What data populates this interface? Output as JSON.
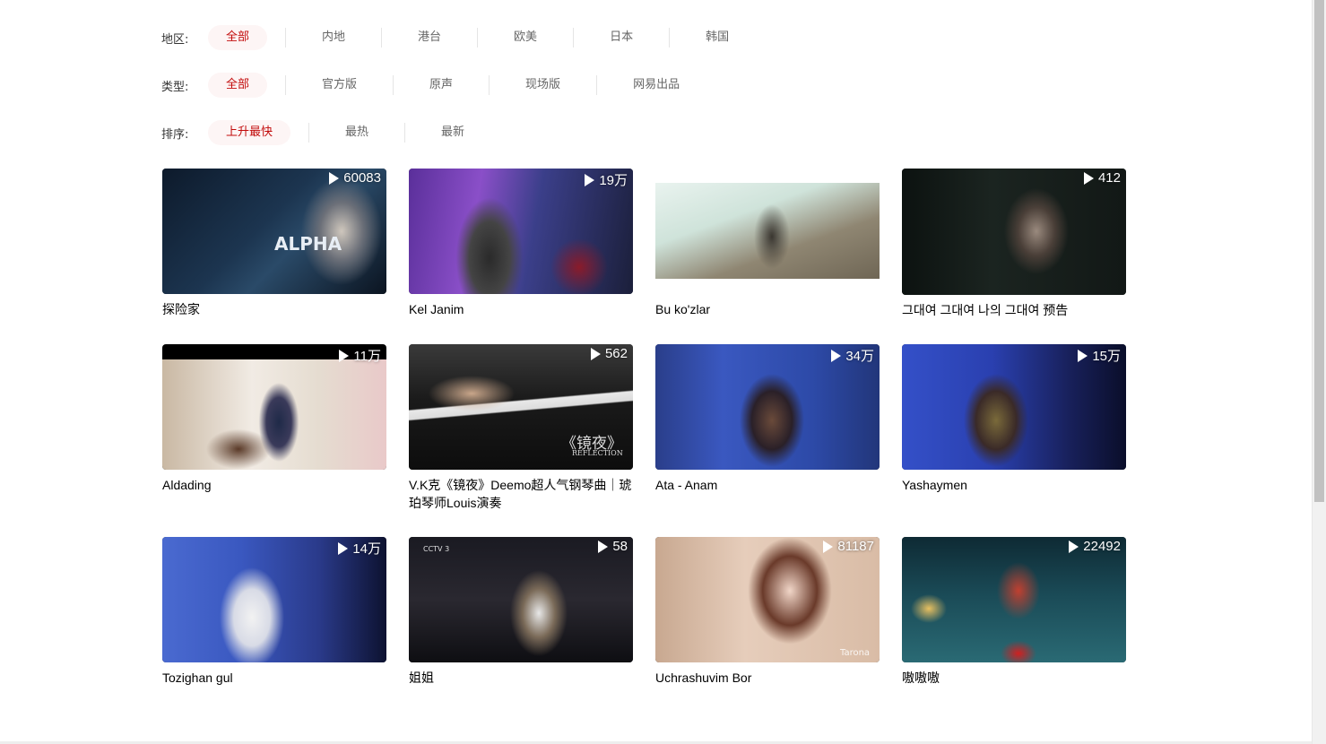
{
  "filters": {
    "region": {
      "label": "地区:",
      "options": [
        "全部",
        "内地",
        "港台",
        "欧美",
        "日本",
        "韩国"
      ]
    },
    "type": {
      "label": "类型:",
      "options": [
        "全部",
        "官方版",
        "原声",
        "现场版",
        "网易出品"
      ]
    },
    "sort": {
      "label": "排序:",
      "options": [
        "上升最快",
        "最热",
        "最新"
      ]
    }
  },
  "videos": [
    {
      "title": "探险家",
      "plays": "60083"
    },
    {
      "title": "Kel Janim",
      "plays": "19万"
    },
    {
      "title": "Bu ko'zlar",
      "plays": ""
    },
    {
      "title": "그대여 그대여 나의 그대여 预告",
      "plays": "412"
    },
    {
      "title": "Aldading",
      "plays": "11万"
    },
    {
      "title": "V.K克《镜夜》Deemo超人气钢琴曲｜琥珀琴师Louis演奏",
      "plays": "562"
    },
    {
      "title": "Ata - Anam",
      "plays": "34万"
    },
    {
      "title": "Yashaymen",
      "plays": "15万"
    },
    {
      "title": "Tozighan gul",
      "plays": "14万"
    },
    {
      "title": "姐姐",
      "plays": "58"
    },
    {
      "title": "Uchrashuvim Bor",
      "plays": "81187"
    },
    {
      "title": "嗷嗷嗷",
      "plays": "22492"
    }
  ],
  "thumb_text": {
    "alpha": "ALPHA",
    "mirror": "《镜夜》",
    "reflection": "REFLECTION",
    "cctv": "CCTV 3",
    "tarona": "Tarona"
  },
  "colors": {
    "accent": "#c20c0c",
    "active_bg": "#fdf5f5"
  }
}
